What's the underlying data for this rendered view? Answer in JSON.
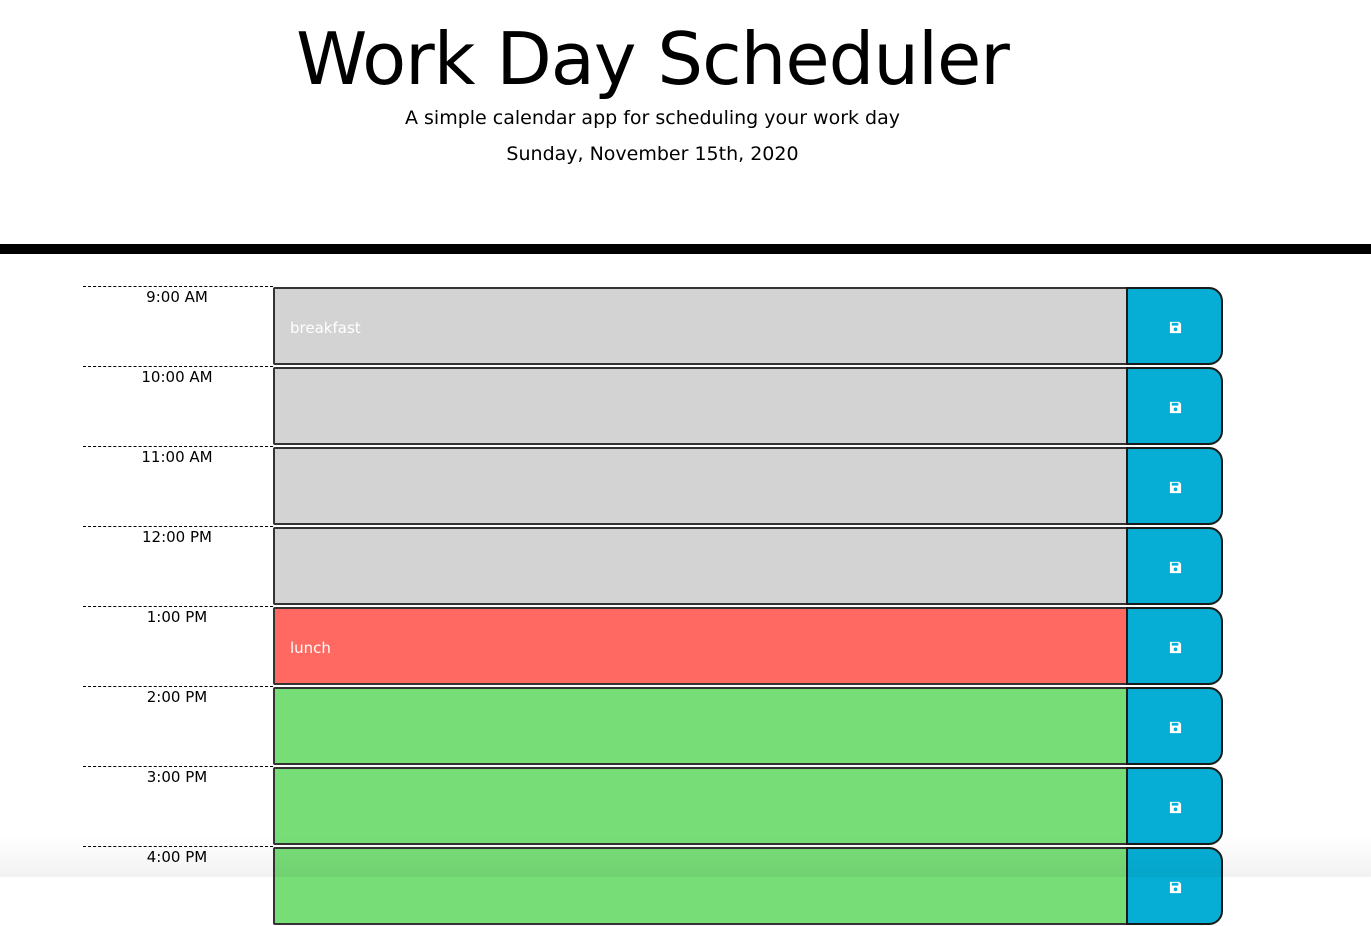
{
  "header": {
    "title": "Work Day Scheduler",
    "subtitle": "A simple calendar app for scheduling your work day",
    "current_date": "Sunday, November 15th, 2020"
  },
  "colors": {
    "past": "#d3d3d3",
    "present": "#ff6961",
    "future": "#77dd77",
    "save_button": "#06aed5",
    "divider": "#000000"
  },
  "schedule": {
    "rows": [
      {
        "hour": "9:00 AM",
        "text": "breakfast",
        "state": "past",
        "save_icon": "save-icon"
      },
      {
        "hour": "10:00 AM",
        "text": "",
        "state": "past",
        "save_icon": "save-icon"
      },
      {
        "hour": "11:00 AM",
        "text": "",
        "state": "past",
        "save_icon": "save-icon"
      },
      {
        "hour": "12:00 PM",
        "text": "",
        "state": "past",
        "save_icon": "save-icon"
      },
      {
        "hour": "1:00 PM",
        "text": "lunch",
        "state": "present",
        "save_icon": "save-icon"
      },
      {
        "hour": "2:00 PM",
        "text": "",
        "state": "future",
        "save_icon": "save-icon"
      },
      {
        "hour": "3:00 PM",
        "text": "",
        "state": "future",
        "save_icon": "save-icon"
      },
      {
        "hour": "4:00 PM",
        "text": "",
        "state": "future",
        "save_icon": "save-icon"
      }
    ]
  }
}
